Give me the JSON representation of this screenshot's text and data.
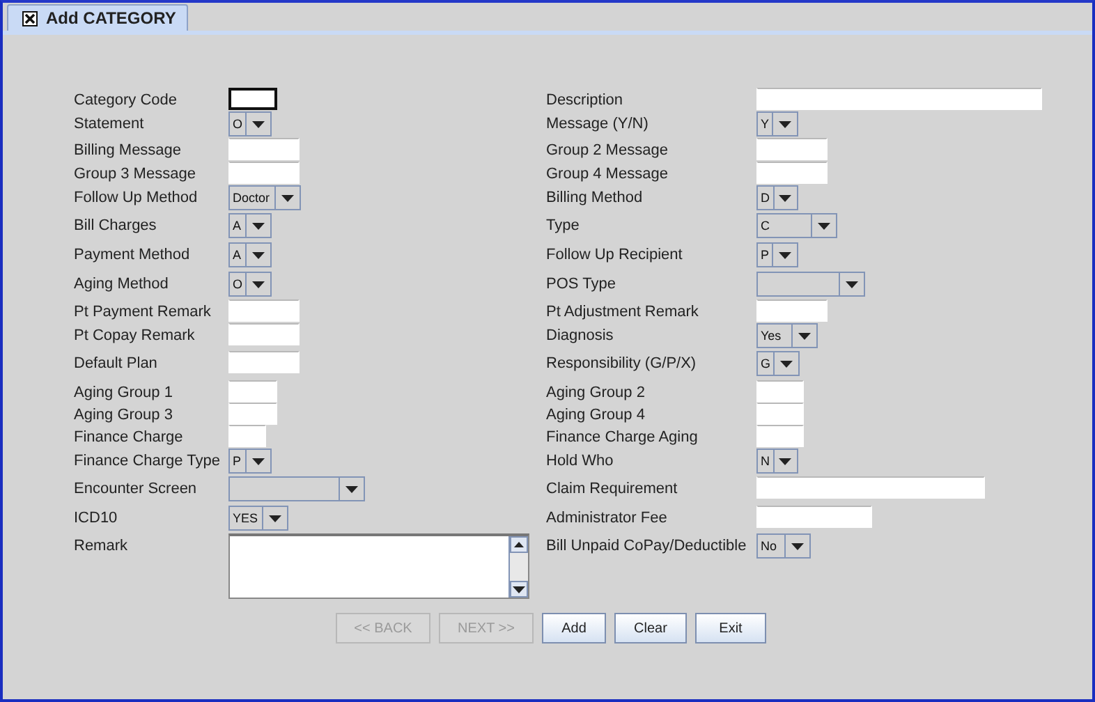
{
  "tab": {
    "title": "Add CATEGORY",
    "selected": true
  },
  "rows": [
    {
      "left": {
        "label": "Category Code",
        "kind": "text",
        "focused": true
      },
      "right": {
        "label": "Description",
        "kind": "text"
      }
    },
    {
      "left": {
        "label": "Statement",
        "kind": "combo",
        "value": "O"
      },
      "right": {
        "label": "Message (Y/N)",
        "kind": "combo",
        "value": "Y"
      }
    },
    {
      "left": {
        "label": "Billing Message",
        "kind": "text"
      },
      "right": {
        "label": "Group 2  Message",
        "kind": "text"
      }
    },
    {
      "left": {
        "label": "Group 3  Message",
        "kind": "text"
      },
      "right": {
        "label": "Group 4  Message",
        "kind": "text"
      }
    },
    {
      "left": {
        "label": "Follow Up Method",
        "kind": "combo",
        "value": "Doctor"
      },
      "right": {
        "label": "Billing Method",
        "kind": "combo",
        "value": "D"
      }
    },
    {
      "left": {
        "label": "Bill Charges",
        "kind": "combo",
        "value": "A"
      },
      "right": {
        "label": "Type",
        "kind": "combo",
        "value": "C"
      }
    },
    {
      "left": {
        "label": "Payment Method",
        "kind": "combo",
        "value": "A"
      },
      "right": {
        "label": "Follow Up Recipient",
        "kind": "combo",
        "value": "P"
      }
    },
    {
      "left": {
        "label": "Aging Method",
        "kind": "combo",
        "value": "O"
      },
      "right": {
        "label": "POS Type",
        "kind": "combo"
      }
    },
    {
      "left": {
        "label": "Pt Payment Remark",
        "kind": "text"
      },
      "right": {
        "label": "Pt Adjustment Remark",
        "kind": "text"
      }
    },
    {
      "left": {
        "label": "Pt Copay Remark",
        "kind": "text"
      },
      "right": {
        "label": "Diagnosis",
        "kind": "combo",
        "value": "Yes"
      }
    },
    {
      "left": {
        "label": "Default Plan",
        "kind": "text"
      },
      "right": {
        "label": "Responsibility (G/P/X)",
        "kind": "combo",
        "value": "G"
      }
    },
    {
      "left": {
        "label": "Aging Group 1",
        "kind": "text"
      },
      "right": {
        "label": "Aging Group 2",
        "kind": "text"
      }
    },
    {
      "left": {
        "label": "Aging Group 3",
        "kind": "text"
      },
      "right": {
        "label": "Aging Group 4",
        "kind": "text"
      }
    },
    {
      "left": {
        "label": "Finance Charge",
        "kind": "text"
      },
      "right": {
        "label": "Finance Charge Aging",
        "kind": "text"
      }
    },
    {
      "left": {
        "label": "Finance Charge Type",
        "kind": "combo",
        "value": "P"
      },
      "right": {
        "label": "Hold Who",
        "kind": "combo",
        "value": "N"
      }
    },
    {
      "left": {
        "label": "Encounter Screen",
        "kind": "combo"
      },
      "right": {
        "label": "Claim Requirement",
        "kind": "text"
      }
    },
    {
      "left": {
        "label": "ICD10",
        "kind": "combo",
        "value": "YES"
      },
      "right": {
        "label": "Administrator Fee",
        "kind": "text"
      }
    },
    {
      "left": {
        "label": "Remark",
        "kind": "textarea"
      },
      "right": {
        "label": "Bill Unpaid CoPay/Deductible",
        "kind": "combo",
        "value": "No"
      }
    }
  ],
  "buttons": [
    {
      "label": "<< BACK",
      "disabled": true
    },
    {
      "label": "NEXT >>",
      "disabled": true
    },
    {
      "label": "Add",
      "disabled": false
    },
    {
      "label": "Clear",
      "disabled": false
    },
    {
      "label": "Exit",
      "disabled": false
    }
  ]
}
